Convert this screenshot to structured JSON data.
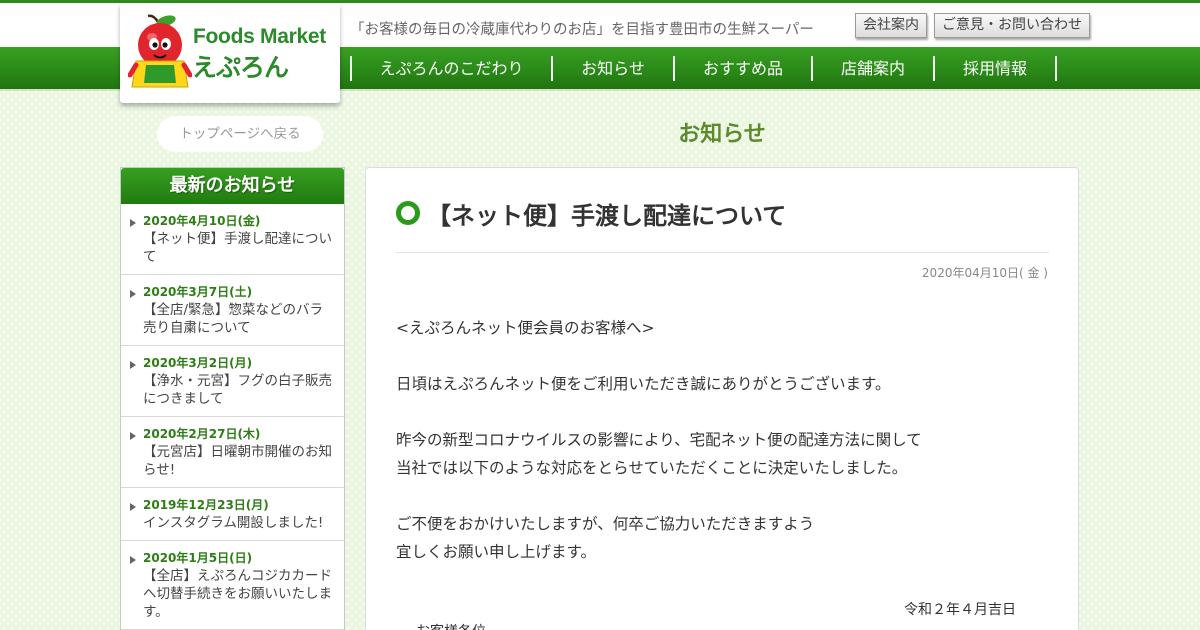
{
  "header": {
    "tagline": "「お客様の毎日の冷蔵庫代わりのお店」を目指す豊田市の生鮮スーパー",
    "company_button": "会社案内",
    "contact_button": "ご意見・お問い合わせ",
    "logo": {
      "line1": "Foods Market",
      "line2": "えぷろん"
    }
  },
  "nav": {
    "items": [
      {
        "label": "えぷろんのこだわり"
      },
      {
        "label": "お知らせ"
      },
      {
        "label": "おすすめ品"
      },
      {
        "label": "店舗案内"
      },
      {
        "label": "採用情報"
      }
    ]
  },
  "back_button": "トップページへ戻る",
  "page_title": "お知らせ",
  "sidebar": {
    "heading": "最新のお知らせ",
    "items": [
      {
        "date": "2020年4月10日(金)",
        "title": "【ネット便】手渡し配達について"
      },
      {
        "date": "2020年3月7日(土)",
        "title": "【全店/緊急】惣菜などのバラ売り自粛について"
      },
      {
        "date": "2020年3月2日(月)",
        "title": "【浄水・元宮】フグの白子販売につきまして"
      },
      {
        "date": "2020年2月27日(木)",
        "title": "【元宮店】日曜朝市開催のお知らせ!"
      },
      {
        "date": "2019年12月23日(月)",
        "title": "インスタグラム開設しました!"
      },
      {
        "date": "2020年1月5日(日)",
        "title": "【全店】えぷろんコジカカードへ切替手続きをお願いいたします。"
      }
    ]
  },
  "article": {
    "title": "【ネット便】手渡し配達について",
    "date": "2020年04月10日( 金 )",
    "lines": {
      "l1": "<えぷろんネット便会員のお客様へ>",
      "l2": "日頃はえぷろんネット便をご利用いただき誠にありがとうございます。",
      "l3": "昨今の新型コロナウイルスの影響により、宅配ネット便の配達方法に関して",
      "l4": "当社では以下のような対応をとらせていただくことに決定いたしました。",
      "l5": "ご不便をおかけいたしますが、何卒ご協力いただきますよう",
      "l6": "宜しくお願い申し上げます。"
    },
    "sign_date": "令和２年４月吉日",
    "greeting": "お客様各位"
  },
  "colors": {
    "brand_green": "#2a8a18",
    "date_green": "#2e7d16",
    "title_green": "#5e8a2e",
    "logo_red": "#d9232a"
  }
}
